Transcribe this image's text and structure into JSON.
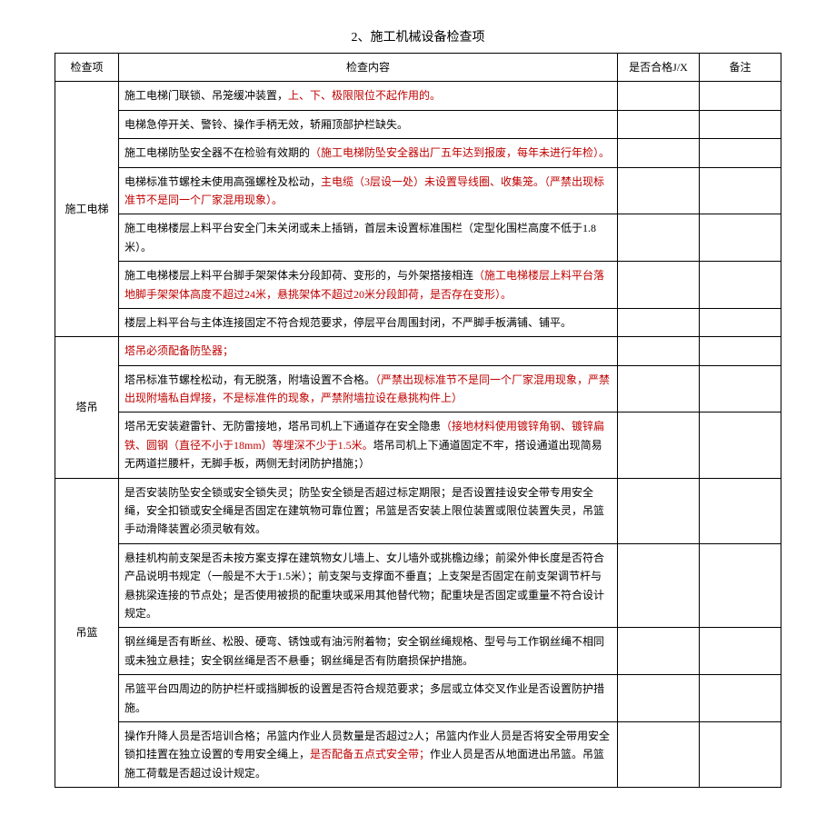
{
  "title": "2、施工机械设备检查项",
  "headers": {
    "item": "检查项",
    "content": "检查内容",
    "pass": "是否合格J/X",
    "remark": "备注"
  },
  "sections": [
    {
      "name": "施工电梯",
      "rows": [
        {
          "parts": [
            {
              "t": "施工电梯门联锁、吊笼缓冲装置，"
            },
            {
              "t": "上、下、极限限位不起作用的。",
              "red": true
            }
          ]
        },
        {
          "parts": [
            {
              "t": "电梯急停开关、警铃、操作手柄无效，轿厢顶部护栏缺失。"
            }
          ]
        },
        {
          "parts": [
            {
              "t": "施工电梯防坠安全器不在检验有效期的"
            },
            {
              "t": "（施工电梯防坠安全器出厂五年达到报废，每年未进行年检）。",
              "red": true
            }
          ]
        },
        {
          "parts": [
            {
              "t": "电梯标准节螺栓未使用高强螺栓及松动，"
            },
            {
              "t": "主电缆（3层设一处）未设置导线圈、收集笼。（严禁出现标准节不是同一个厂家混用现象）。",
              "red": true
            }
          ]
        },
        {
          "parts": [
            {
              "t": "施工电梯楼层上料平台安全门未关闭或未上插销，首层未设置标准围栏（定型化围栏高度不低于1.8米）。"
            }
          ]
        },
        {
          "parts": [
            {
              "t": "施工电梯楼层上料平台脚手架架体未分段卸荷、变形的，与外架搭接相连"
            },
            {
              "t": "（施工电梯楼层上料平台落地脚手架架体高度不超过24米，悬挑架体不超过20米分段卸荷，是否存在变形）。",
              "red": true
            }
          ]
        },
        {
          "parts": [
            {
              "t": "楼层上料平台与主体连接固定不符合规范要求，停层平台周围封闭，不严脚手板满铺、铺平。"
            }
          ]
        }
      ]
    },
    {
      "name": "塔吊",
      "rows": [
        {
          "parts": [
            {
              "t": "塔吊必须配备防坠器；",
              "red": true
            }
          ]
        },
        {
          "parts": [
            {
              "t": "塔吊标准节螺栓松动，有无脱落，附墙设置不合格。"
            },
            {
              "t": "（严禁出现标准节不是同一个厂家混用现象，严禁出现附墙私自焊接，不是标准件的现象，严禁附墙拉设在悬挑构件上）",
              "red": true
            }
          ]
        },
        {
          "parts": [
            {
              "t": "塔吊无安装避雷针、无防雷接地，塔吊司机上下通道存在安全隐患"
            },
            {
              "t": "（接地材料使用镀锌角钢、镀锌扁铁、圆钢（直径不小于18mm）等埋深不少于1.5米。",
              "red": true
            },
            {
              "t": "塔吊司机上下通道固定不牢，搭设通道出现简易无两道拦腰杆，无脚手板，两侧无封闭防护措施；）"
            }
          ]
        }
      ]
    },
    {
      "name": "吊篮",
      "rows": [
        {
          "parts": [
            {
              "t": "是否安装防坠安全锁或安全锁失灵；防坠安全锁是否超过标定期限；是否设置挂设安全带专用安全绳，安全扣锁或安全绳是否固定在建筑物可靠位置；吊篮是否安装上限位装置或限位装置失灵，吊篮手动滑降装置必须灵敏有效。"
            }
          ]
        },
        {
          "parts": [
            {
              "t": "悬挂机构前支架是否未按方案支撑在建筑物女儿墙上、女儿墙外或挑檐边缘；前梁外伸长度是否符合产品说明书规定（一般是不大于1.5米）；前支架与支撑面不垂直；上支架是否固定在前支架调节杆与悬挑梁连接的节点处；是否使用被损的配重块或采用其他替代物；配重块是否固定或重量不符合设计规定。"
            }
          ]
        },
        {
          "parts": [
            {
              "t": "钢丝绳是否有断丝、松股、硬弯、锈蚀或有油污附着物；安全钢丝绳规格、型号与工作钢丝绳不相同或未独立悬挂；安全钢丝绳是否不悬垂；钢丝绳是否有防磨损保护措施。"
            }
          ]
        },
        {
          "parts": [
            {
              "t": "吊篮平台四周边的防护栏杆或挡脚板的设置是否符合规范要求；多层或立体交叉作业是否设置防护措施。"
            }
          ]
        },
        {
          "parts": [
            {
              "t": "操作升降人员是否培训合格；吊篮内作业人员数量是否超过2人；吊篮内作业人员是否将安全带用安全锁扣挂置在独立设置的专用安全绳上，"
            },
            {
              "t": "是否配备五点式安全带；",
              "red": true
            },
            {
              "t": "作业人员是否从地面进出吊篮。吊篮施工荷载是否超过设计规定。"
            }
          ]
        }
      ]
    }
  ]
}
